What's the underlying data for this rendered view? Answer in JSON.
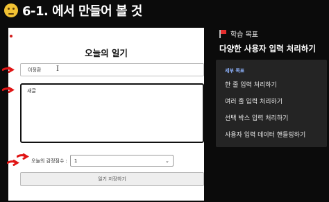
{
  "header": {
    "title": "6-1. 에서 만들어 볼 것",
    "emoji_icon": "thinking-face-icon"
  },
  "demo": {
    "title": "오늘의 일기",
    "author_value": "이정환",
    "content_value": "새글",
    "emotion_label": "오늘의 감정점수 :",
    "emotion_value": "1",
    "save_label": "일기 저장하기"
  },
  "goals": {
    "heading": "학습 목표",
    "main": "다양한 사용자 입력 처리하기",
    "detail_label": "세부 목표",
    "items": [
      "한 줄 입력 처리하기",
      "여러 줄 입력 처리하기",
      "선택 박스 입력 처리하기",
      "사용자 입력 데이터 핸들링하기"
    ]
  },
  "colors": {
    "arrow": "#e01515",
    "detail_label": "#8fb4ff",
    "box": "#242424"
  }
}
